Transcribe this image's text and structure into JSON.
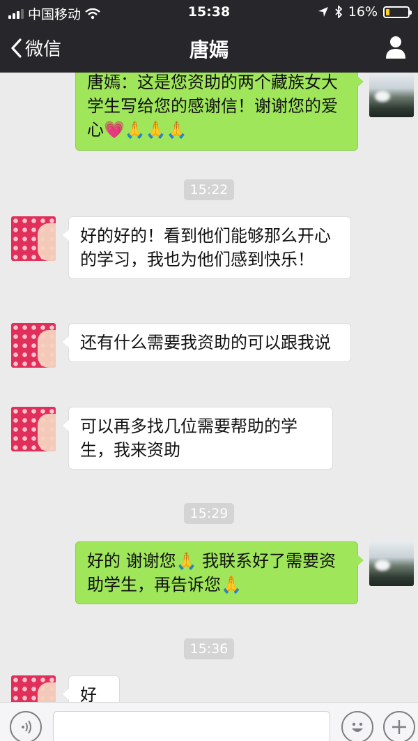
{
  "status_bar": {
    "carrier": "中国移动",
    "time": "15:38",
    "battery_percent": "16%",
    "battery_level": 0.16,
    "icons": [
      "signal-icon",
      "wifi-icon",
      "location-icon",
      "bluetooth-icon",
      "battery-icon"
    ]
  },
  "nav": {
    "back_label": "微信",
    "title": "唐嫣",
    "right_icon": "person-icon"
  },
  "messages": [
    {
      "side": "out",
      "text": "唐嫣：这是您资助的两个藏族女大学生写给您的感谢信！谢谢您的爱心💗🙏🙏🙏"
    },
    {
      "type": "timestamp",
      "text": "15:22"
    },
    {
      "side": "in",
      "text": "好的好的！看到他们能够那么开心的学习，我也为他们感到快乐！"
    },
    {
      "side": "in",
      "text": "还有什么需要我资助的可以跟我说"
    },
    {
      "side": "in",
      "text": "可以再多找几位需要帮助的学生，我来资助"
    },
    {
      "type": "timestamp",
      "text": "15:29"
    },
    {
      "side": "out",
      "text": "好的 谢谢您🙏 我联系好了需要资助学生，再告诉您🙏"
    },
    {
      "type": "timestamp",
      "text": "15:36"
    },
    {
      "side": "in",
      "text": "好"
    }
  ],
  "input_bar": {
    "icons": [
      "voice-icon",
      "emoji-icon",
      "plus-icon"
    ]
  },
  "colors": {
    "header": "#27272b",
    "background": "#ebebeb",
    "outgoing_bubble": "#9fe65b",
    "incoming_bubble": "#ffffff",
    "timestamp_bg": "#d4d4d4",
    "battery": "#ffd21f"
  }
}
